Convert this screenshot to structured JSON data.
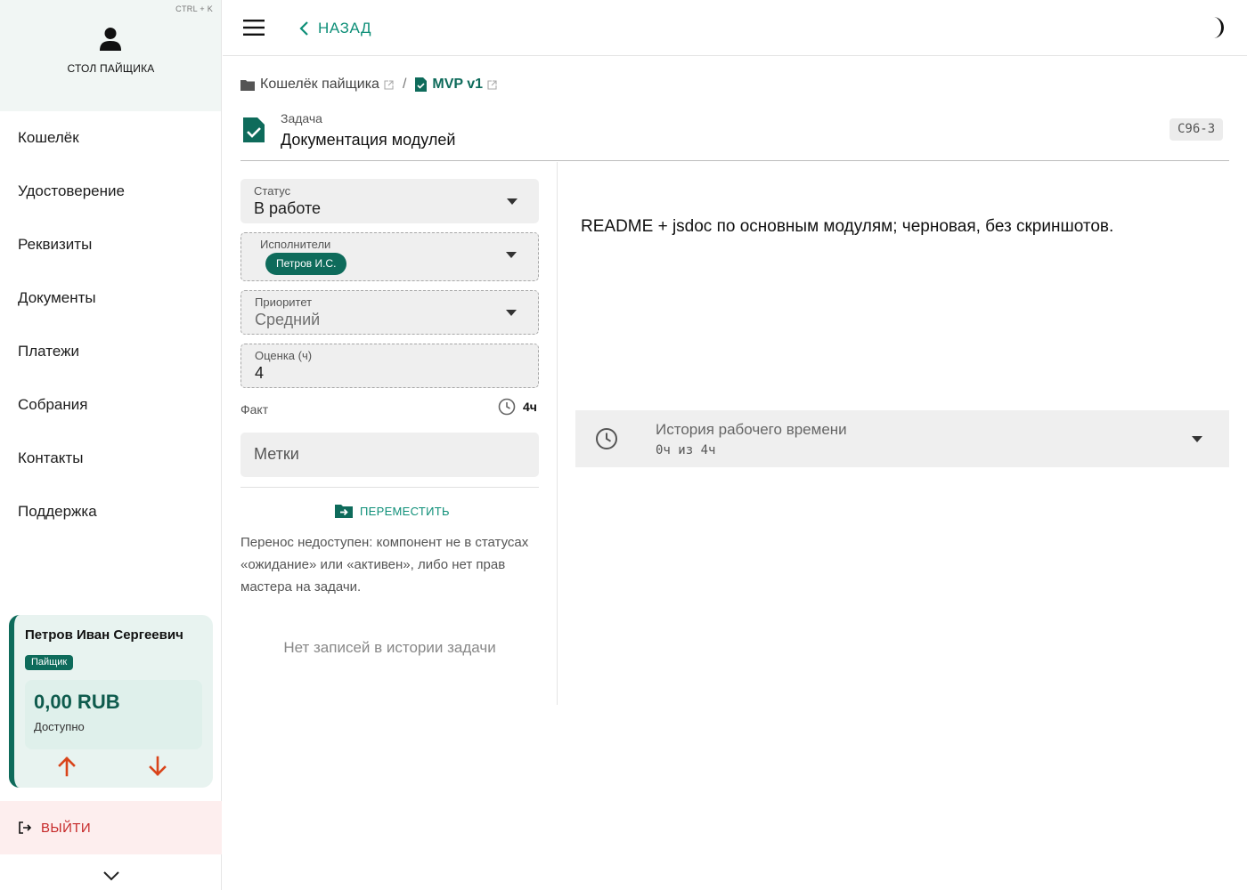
{
  "sidebar": {
    "hotkey": "CTRL + K",
    "title": "СТОЛ ПАЙЩИКА",
    "items": [
      {
        "label": "Кошелёк"
      },
      {
        "label": "Удостоверение"
      },
      {
        "label": "Реквизиты"
      },
      {
        "label": "Документы"
      },
      {
        "label": "Платежи"
      },
      {
        "label": "Собрания"
      },
      {
        "label": "Контакты"
      },
      {
        "label": "Поддержка"
      }
    ],
    "user_card": {
      "name": "Петров Иван Сергеевич",
      "role": "Пайщик",
      "balance": "0,00 RUB",
      "balance_label": "Доступно"
    },
    "logout_label": "ВЫЙТИ"
  },
  "topbar": {
    "back_label": "НАЗАД"
  },
  "breadcrumb": {
    "project": "Кошелёк пайщика",
    "issue": "MVP v1"
  },
  "task": {
    "type_label": "Задача",
    "title": "Документация модулей",
    "code": "С96-3",
    "description": "README + jsdoc по основным модулям; черновая, без скриншотов."
  },
  "form": {
    "status": {
      "label": "Статус",
      "value": "В работе"
    },
    "assignees": {
      "label": "Исполнители",
      "chips": [
        "Петров И.С."
      ]
    },
    "priority": {
      "label": "Приоритет",
      "value": "Средний"
    },
    "estimate": {
      "label": "Оценка (ч)",
      "value": "4"
    },
    "fact": {
      "label": "Факт",
      "value": "4ч"
    },
    "tags_placeholder": "Метки",
    "move_label": "ПЕРЕМЕСТИТЬ",
    "move_note": "Перенос недоступен: компонент не в статусах «ожидание» или «активен», либо нет прав мастера на задачи.",
    "no_history": "Нет записей в истории задачи"
  },
  "work_history": {
    "title": "История рабочего времени",
    "subtitle": "0ч из 4ч"
  },
  "colors": {
    "accent": "#0e6b5b",
    "accent_light": "#0e8f78",
    "danger": "#c62828",
    "arrow": "#d9441a"
  },
  "icons": [
    "user-icon",
    "menu-icon",
    "chevron-left-icon",
    "moon-icon",
    "folder-icon",
    "task-check-icon",
    "external-link-icon",
    "caret-down-icon",
    "clock-icon",
    "folder-move-icon",
    "arrow-up-icon",
    "arrow-down-icon",
    "logout-icon",
    "chevron-down-icon"
  ]
}
